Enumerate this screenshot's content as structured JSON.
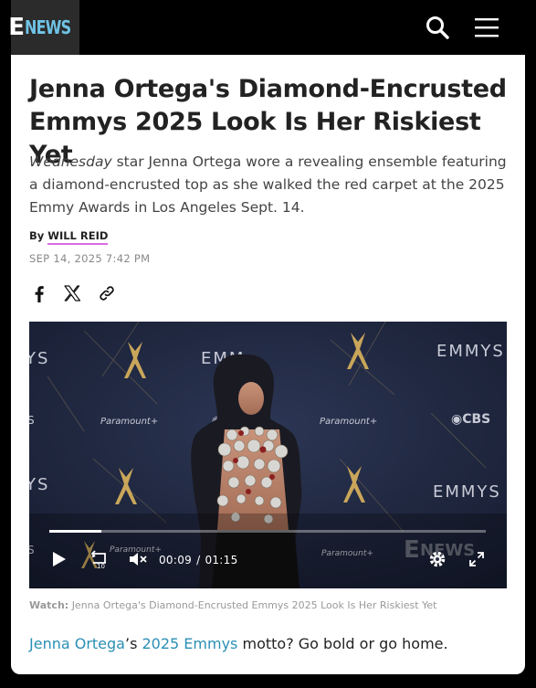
{
  "nav": {
    "logo_e": "E",
    "logo_news": "NEWS",
    "search_icon": "search-icon",
    "menu_icon": "hamburger-menu-icon"
  },
  "article": {
    "headline": "Jenna Ortega's Diamond-Encrusted Emmys 2025 Look Is Her Riskiest Yet",
    "dek_em": "Wednesday",
    "dek_rest": " star Jenna Ortega wore a revealing ensemble featuring a diamond-encrusted top as she walked the red carpet at the 2025 Emmy Awards in Los Angeles Sept. 14.",
    "by_label": "By",
    "author": "WILL REID",
    "date": "SEP 14, 2025 7:42 PM",
    "share": [
      "facebook-icon",
      "x-icon",
      "link-icon"
    ]
  },
  "video": {
    "current_time": "00:09",
    "separator": "/",
    "duration": "01:15",
    "progress": 0.12,
    "backdrop_texts": [
      "EMMYS",
      "EMMYS",
      "EMMYS",
      "EMMYS",
      "Paramount+",
      "Paramount+",
      "CBS",
      "CBS"
    ],
    "watermark": "E NEWS"
  },
  "caption": {
    "label": "Watch:",
    "text": "Jenna Ortega's Diamond-Encrusted Emmys 2025 Look Is Her Riskiest Yet"
  },
  "body": {
    "link1": "Jenna Ortega",
    "apostrophe": "’s ",
    "link2": "2025 Emmys",
    "rest": " motto? Go bold or go home."
  },
  "colors": {
    "brand_blue": "#6fc3e4",
    "link": "#2a8fb5",
    "author_underline": "#d96ce0"
  }
}
